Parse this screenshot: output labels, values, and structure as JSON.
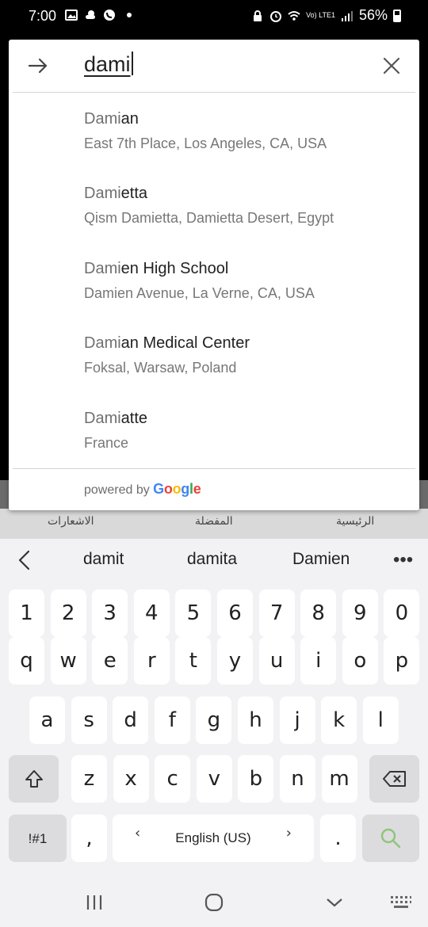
{
  "status_bar": {
    "time": "7:00",
    "battery": "56%",
    "network": "Vo) LTE1"
  },
  "search": {
    "query": "dami"
  },
  "results": [
    {
      "match": "Dami",
      "rest": "an",
      "subtitle": "East 7th Place, Los Angeles, CA, USA"
    },
    {
      "match": "Dami",
      "rest": "etta",
      "subtitle": "Qism Damietta, Damietta Desert, Egypt"
    },
    {
      "match": "Dami",
      "rest": "en High School",
      "subtitle": "Damien Avenue, La Verne, CA, USA"
    },
    {
      "match": "Dami",
      "rest": "an Medical Center",
      "subtitle": "Foksal, Warsaw, Poland"
    },
    {
      "match": "Dami",
      "rest": "atte",
      "subtitle": "France"
    }
  ],
  "attribution": {
    "powered_by": "powered by",
    "brand": [
      "G",
      "o",
      "o",
      "g",
      "l",
      "e"
    ],
    "brand_colors": [
      "#4285F4",
      "#EA4335",
      "#FBBC05",
      "#4285F4",
      "#34A853",
      "#EA4335"
    ]
  },
  "app_tabs": {
    "left": "الاشعارات",
    "center": "المفضلة",
    "right": "الرئيسية"
  },
  "keyboard": {
    "suggestions": [
      "damit",
      "damita",
      "Damien"
    ],
    "row_numbers": [
      "1",
      "2",
      "3",
      "4",
      "5",
      "6",
      "7",
      "8",
      "9",
      "0"
    ],
    "row_q": [
      "q",
      "w",
      "e",
      "r",
      "t",
      "y",
      "u",
      "i",
      "o",
      "p"
    ],
    "row_a": [
      "a",
      "s",
      "d",
      "f",
      "g",
      "h",
      "j",
      "k",
      "l"
    ],
    "row_z": [
      "z",
      "x",
      "c",
      "v",
      "b",
      "n",
      "m"
    ],
    "symbols_key": "!#1",
    "comma_key": ",",
    "space_label": "English (US)",
    "period_key": ".",
    "accent_color": "#8fc57a"
  }
}
